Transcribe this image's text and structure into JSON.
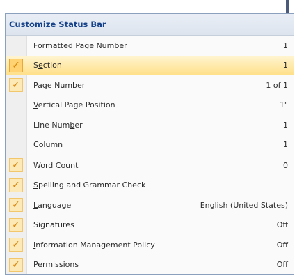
{
  "menu": {
    "title": "Customize Status Bar",
    "items": [
      {
        "label": "Formatted Page Number",
        "accel": "F",
        "value": "1",
        "checked": false
      },
      {
        "label": "Section",
        "accel": "e",
        "value": "1",
        "checked": true,
        "highlighted": true
      },
      {
        "label": "Page Number",
        "accel": "P",
        "value": "1 of 1",
        "checked": true
      },
      {
        "label": "Vertical Page Position",
        "accel": "V",
        "value": "1\"",
        "checked": false
      },
      {
        "label": "Line Number",
        "accel": "b",
        "value": "1",
        "checked": false
      },
      {
        "label": "Column",
        "accel": "C",
        "value": "1",
        "checked": false
      },
      {
        "label": "Word Count",
        "accel": "W",
        "value": "0",
        "checked": true
      },
      {
        "label": "Spelling and Grammar Check",
        "accel": "S",
        "value": "",
        "checked": true
      },
      {
        "label": "Language",
        "accel": "L",
        "value": "English (United States)",
        "checked": true
      },
      {
        "label": "Signatures",
        "accel": "",
        "value": "Off",
        "checked": true
      },
      {
        "label": "Information Management Policy",
        "accel": "I",
        "value": "Off",
        "checked": true
      },
      {
        "label": "Permissions",
        "accel": "P",
        "value": "Off",
        "checked": true
      }
    ]
  },
  "check_glyph": "✓",
  "colors": {
    "header_text": "#15428b",
    "highlight": "#ffe08a",
    "check": "#d8860c"
  }
}
